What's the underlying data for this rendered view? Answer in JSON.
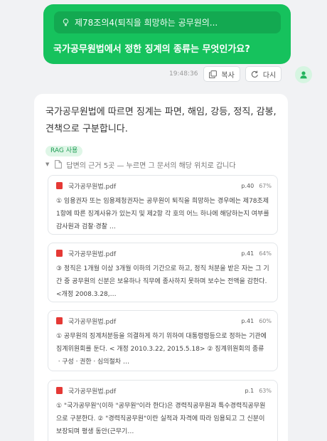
{
  "conversation": {
    "user_message": {
      "quote": "제78조의4(퇴직을 희망하는 공무원의...",
      "text": "국가공무원법에서 정한 징계의 종류는 무엇인가요?",
      "time": "19:48:36",
      "copy_label": "복사",
      "retry_label": "다시"
    },
    "assistant": {
      "answer": "국가공무원법에 따르면 징계는 파면, 해임, 강등, 정직, 감봉, 견책으로 구분합니다.",
      "rag_badge": "RAG 사용",
      "sources_header": "답변의 근거 5곳 — 누르면 그 문서의 해당 위치로 갑니다",
      "sources": [
        {
          "file": "국가공무원법.pdf",
          "page": "p.40",
          "score": "67%",
          "snippet": "① 임용권자 또는 임용제청권자는 공무원이 퇴직을 희망하는 경우에는 제78조제1항에 따른 징계사유가 있는지 및 제2항 각 호의 어느 하나에 해당하는지 여부를 감사원과 검찰·경찰 …"
        },
        {
          "file": "국가공무원법.pdf",
          "page": "p.41",
          "score": "64%",
          "snippet": "③ 정직은 1개월 이상 3개월 이하의 기간으로 하고, 정직 처분을 받은 자는 그 기간 중 공무원의 신분은 보유하나 직무에 종사하지 못하며 보수는 전액을 감한다. <개정 2008.3.28,…"
        },
        {
          "file": "국가공무원법.pdf",
          "page": "p.41",
          "score": "60%",
          "snippet": "① 공무원의 징계처분등을 의결하게 하기 위하여 대통령령등으로 정하는 기관에 징계위원회를 둔다. < 개정 2010.3.22, 2015.5.18> ② 징계위원회의 종류ㆍ구성ㆍ권한ㆍ심의절차 …"
        },
        {
          "file": "국가공무원법.pdf",
          "page": "p.1",
          "score": "63%",
          "snippet": "① \"국가공무원\"(이하 \"공무원\"이라 한다)은 경력직공무원과 특수경력직공무원으로 구분한다. ② \"경력직공무원\"이란 실적과 자격에 따라 임용되고 그 신분이 보장되며 평생 동안(근무기…"
        }
      ]
    }
  },
  "icons": {
    "quote": "lightbulb-icon",
    "copy": "copy-icon",
    "retry": "refresh-icon",
    "avatar": "user-icon",
    "document": "document-icon",
    "pdf": "pdf-file-icon",
    "toggle": "triangle-down-icon"
  },
  "colors": {
    "user_bubble": "#16c25d",
    "quote_chip": "#13a951",
    "rag_badge_bg": "#dff6e7",
    "rag_badge_text": "#1f9d55",
    "pdf_icon": "#e53935",
    "page_background": "#f1f2f4"
  }
}
